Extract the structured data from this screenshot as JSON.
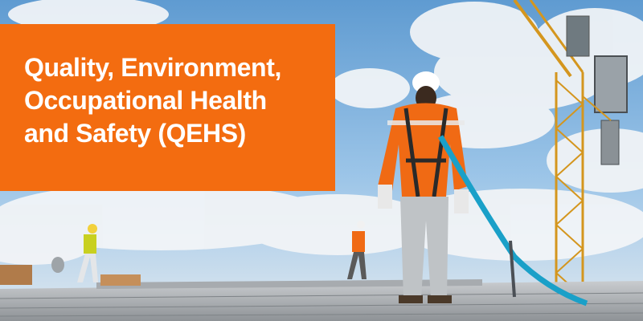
{
  "banner": {
    "title_lines": [
      "Quality, Environment,",
      "Occupational Health",
      "and Safety (QEHS)"
    ],
    "accent_color": "#f36c10",
    "text_color": "#ffffff"
  },
  "photo": {
    "subjects": [
      "worker-in-harness",
      "distant-worker-left",
      "distant-worker-middle",
      "tower-crane",
      "metal-roof",
      "safety-lanyard"
    ],
    "colors": {
      "sky": "#8fbde6",
      "cloud": "#f3f5f7",
      "roof": "#b9bcbf",
      "crane": "#d4961e",
      "hi_vis": "#f06a14",
      "lanyard": "#1aa0c8"
    }
  }
}
